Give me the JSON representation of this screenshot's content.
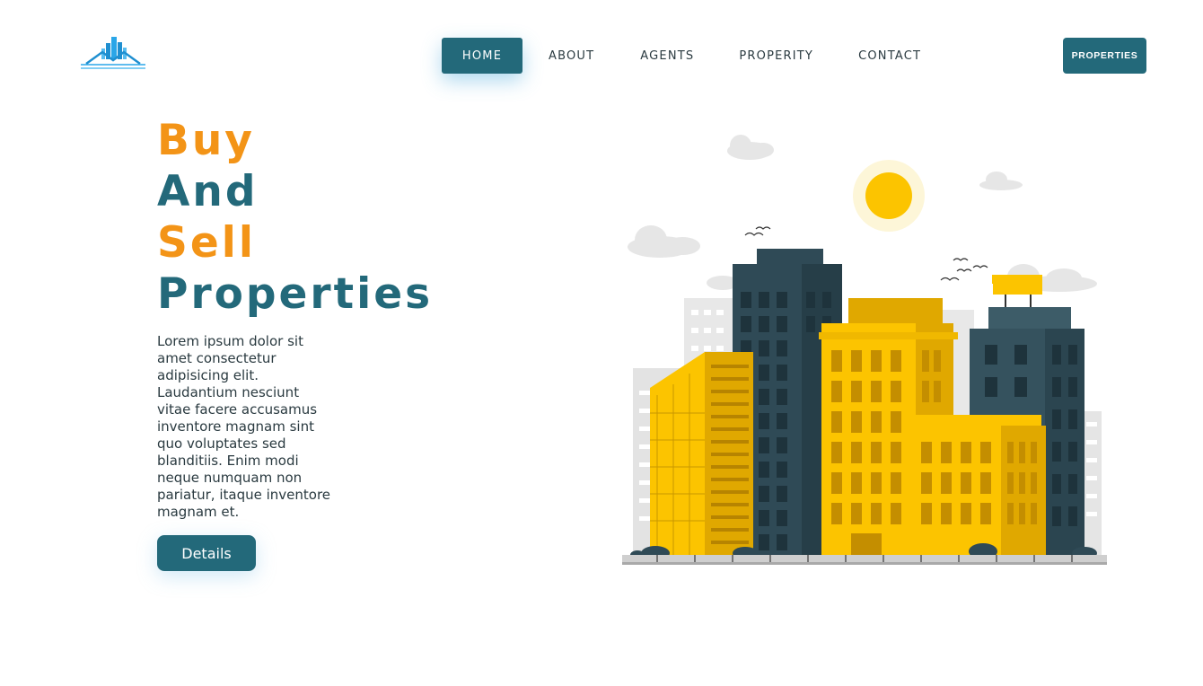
{
  "header": {
    "logo_icon": "city-skyline-logo-icon",
    "nav": [
      {
        "label": "HOME",
        "active": true
      },
      {
        "label": "ABOUT"
      },
      {
        "label": "AGENTS"
      },
      {
        "label": "PROPERITY"
      },
      {
        "label": "CONTACT"
      }
    ],
    "cta_label": "PROPERTIES"
  },
  "hero": {
    "title_lines": [
      "Buy",
      "And",
      "Sell",
      "Properties"
    ],
    "description": "Lorem ipsum dolor sit amet consectetur adipisicing elit. Laudantium nesciunt vitae facere accusamus inventore magnam sint quo voluptates sed blanditiis. Enim modi neque numquam non pariatur, itaque inventore magnam et.",
    "button_label": "Details",
    "illustration": "city-buildings-illustration"
  },
  "colors": {
    "accent_teal": "#23697a",
    "accent_orange": "#f39417",
    "building_yellow": "#fcc400",
    "building_dark": "#2f4a56",
    "sun": "#fcc400"
  }
}
